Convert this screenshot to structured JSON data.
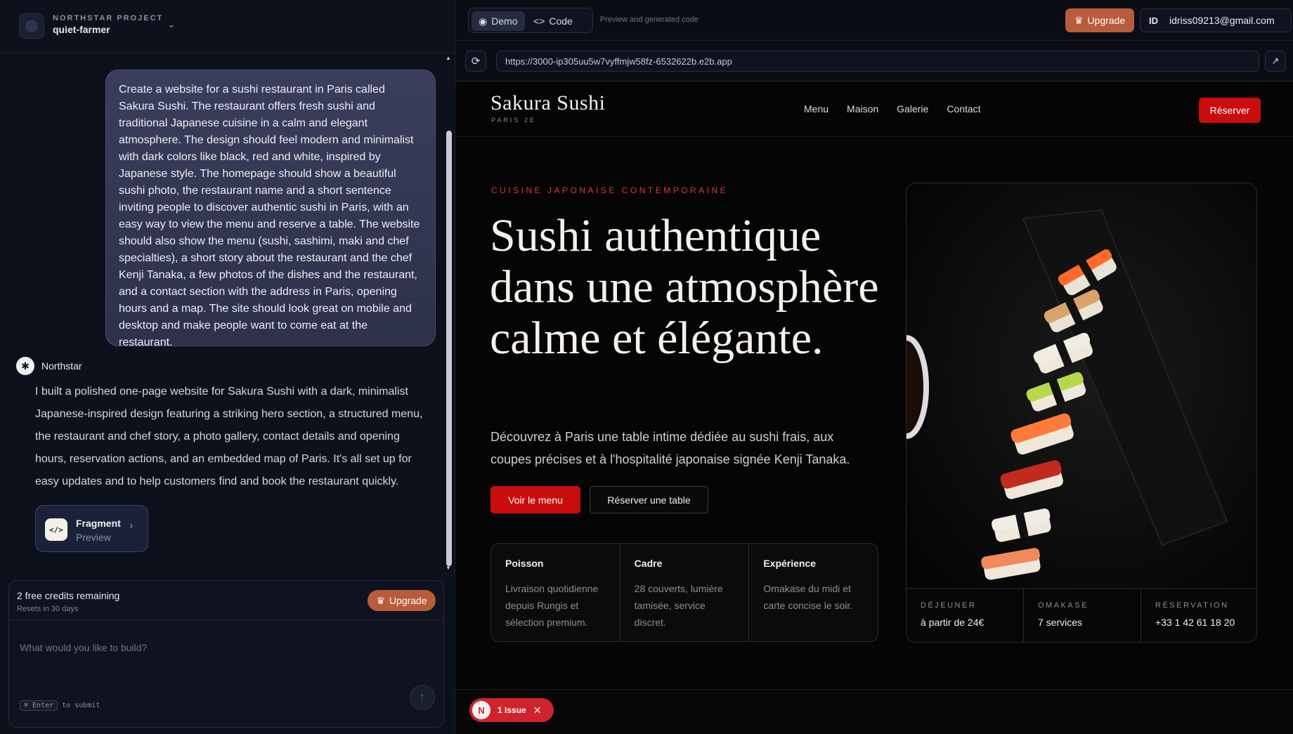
{
  "project": {
    "label": "NORTHSTAR PROJECT",
    "name": "quiet-farmer"
  },
  "chat": {
    "user_message": "Create a website for a sushi restaurant in Paris called Sakura Sushi. The restaurant offers fresh sushi and traditional Japanese cuisine in a calm and elegant atmosphere. The design should feel modern and minimalist with dark colors like black, red and white, inspired by Japanese style. The homepage should show a beautiful sushi photo, the restaurant name and a short sentence inviting people to discover authentic sushi in Paris, with an easy way to view the menu and reserve a table. The website should also show the menu (sushi, sashimi, maki and chef specialties), a short story about the restaurant and the chef Kenji Tanaka, a few photos of the dishes and the restaurant, and a contact section with the address in Paris, opening hours and a map. The site should look great on mobile and desktop and make people want to come eat at the restaurant.",
    "bot_name": "Northstar",
    "bot_message": "I built a polished one-page website for Sakura Sushi with a dark, minimalist Japanese-inspired design featuring a striking hero section, a structured menu, the restaurant and chef story, a photo gallery, contact details and opening hours, reservation actions, and an embedded map of Paris. It's all set up for easy updates and to help customers find and book the restaurant quickly.",
    "fragment": {
      "icon": "</>",
      "title": "Fragment",
      "subtitle": "Preview"
    }
  },
  "composer": {
    "credits_title": "2 free credits remaining",
    "credits_sub": "Resets in 30 days",
    "upgrade_label": "Upgrade",
    "placeholder": "What would you like to build?",
    "hint_key": "⌘ Enter",
    "hint_text": "to submit"
  },
  "topbar": {
    "tab_demo": "Demo",
    "tab_code": "Code",
    "hint": "Preview and generated code",
    "upgrade_label": "Upgrade",
    "account_initials": "ID",
    "account_email": "idriss09213@gmail.com"
  },
  "browser": {
    "url": "https://3000-ip305uu5w7vyffmjw58fz-6532622b.e2b.app"
  },
  "site": {
    "brand": "Sakura Sushi",
    "brand_sub": "PARIS 2E",
    "nav": [
      "Menu",
      "Maison",
      "Galerie",
      "Contact"
    ],
    "nav_cta": "Réserver",
    "eyebrow": "CUISINE JAPONAISE CONTEMPORAINE",
    "hero_title": "Sushi authentique dans une atmosphère calme et élégante.",
    "hero_desc": "Découvrez à Paris une table intime dédiée au sushi frais, aux coupes précises et à l'hospitalité japonaise signée Kenji Tanaka.",
    "btn_menu": "Voir le menu",
    "btn_reserve": "Réserver une table",
    "features": [
      {
        "title": "Poisson",
        "text": "Livraison quotidienne depuis Rungis et sélection premium."
      },
      {
        "title": "Cadre",
        "text": "28 couverts, lumière tamisée, service discret."
      },
      {
        "title": "Expérience",
        "text": "Omakase du midi et carte concise le soir."
      }
    ],
    "stats": [
      {
        "label": "DÉJEUNER",
        "value": "à partir de 24€"
      },
      {
        "label": "OMAKASE",
        "value": "7 services"
      },
      {
        "label": "RÉSERVATION",
        "value": "+33 1 42 61 18 20"
      }
    ]
  },
  "issues": {
    "badge_letter": "N",
    "label": "1 Issue"
  },
  "colors": {
    "accent_red": "#c90d0d",
    "upgrade_orange": "#b85c3b",
    "issue_red": "#d1232e"
  }
}
